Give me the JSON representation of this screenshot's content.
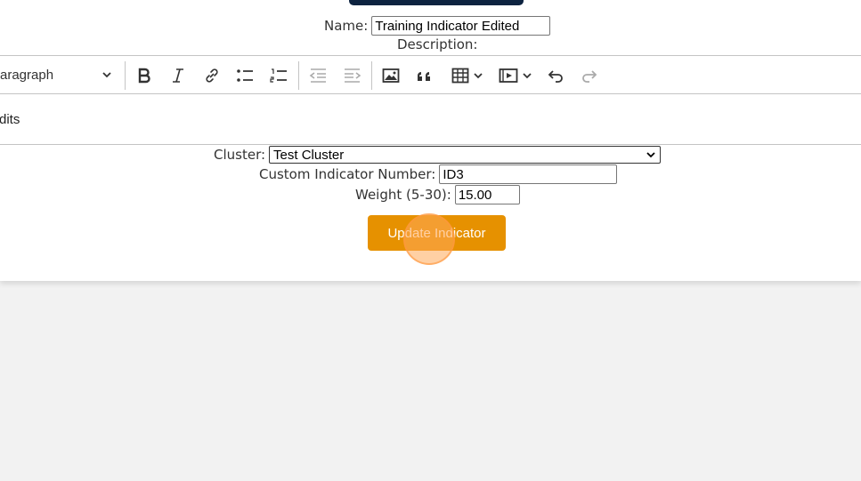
{
  "form": {
    "name_label": "Name:",
    "name_value": "Training Indicator Edited",
    "description_label": "Description:",
    "cluster_label": "Cluster:",
    "cluster_value": "Test Cluster",
    "custom_number_label": "Custom Indicator Number:",
    "custom_number_value": "ID3",
    "weight_label": "Weight (5-30):",
    "weight_value": "15.00",
    "submit_label": "Update Indicator"
  },
  "toolbar": {
    "heading_value": "aragraph",
    "icons": [
      "bold-icon",
      "italic-icon",
      "link-icon",
      "bulleted-list-icon",
      "numbered-list-icon",
      "outdent-icon",
      "indent-icon",
      "image-icon",
      "blockquote-icon",
      "table-icon",
      "media-icon",
      "undo-icon",
      "redo-icon"
    ]
  },
  "editor": {
    "content": "dits"
  },
  "colors": {
    "accent": "#e69100",
    "header_bar": "#0d2340"
  }
}
